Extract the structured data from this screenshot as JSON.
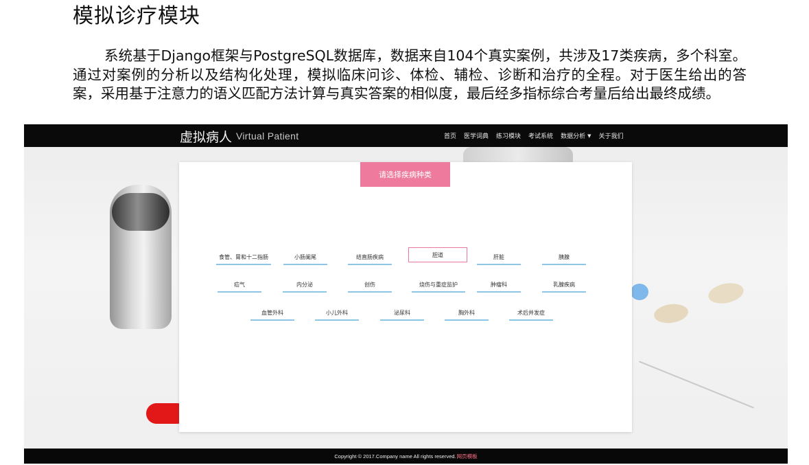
{
  "slide": {
    "title": "模拟诊疗模块",
    "body": "系统基于Django框架与PostgreSQL数据库，数据来自104个真实案例，共涉及17类疾病，多个科室。通过对案例的分析以及结构化处理，模拟临床问诊、体检、辅检、诊断和治疗的全程。对于医生给出的答案，采用基于注意力的语义匹配方法计算与真实答案的相似度，最后经多指标综合考量后给出最终成绩。"
  },
  "navbar": {
    "brand_cn": "虚拟病人",
    "brand_en": "Virtual Patient",
    "links": [
      "首页",
      "医学词典",
      "练习模块",
      "考试系统",
      "数据分析",
      "关于我们"
    ]
  },
  "panel": {
    "select_button": "请选择疾病种类",
    "categories": [
      "食管、胃和十二指肠",
      "小肠阑尾",
      "结直肠疾病",
      "胆道",
      "肝脏",
      "胰腺",
      "疝气",
      "内分泌",
      "创伤",
      "烧伤与重症监护",
      "肿瘤科",
      "乳腺疾病",
      "血管外科",
      "小儿外科",
      "泌尿科",
      "胸外科",
      "术后并发症"
    ],
    "selected": "胆道"
  },
  "footer": {
    "copyright": "Copyright © 2017.Company name All rights reserved.",
    "link": "网页模板"
  },
  "colors": {
    "accent_pink": "#ee7a9d",
    "underline_blue": "#8cc6e6",
    "navbar_bg": "#0a0a0a"
  }
}
